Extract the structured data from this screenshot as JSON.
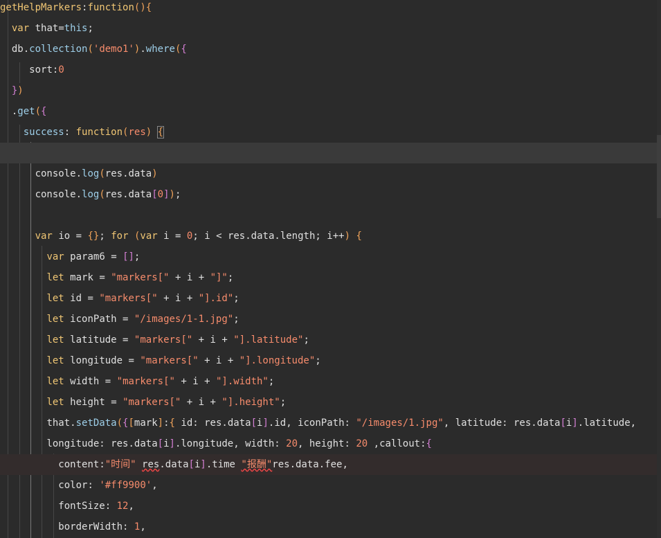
{
  "editor": {
    "lines": [
      "getHelpMarkers:function(){",
      "  var that=this;",
      "  db.collection('demo1').where({",
      "      sort:0",
      "  })",
      "  .get({",
      "    success: function(res) {",
      "",
      "      console.log(res.data)",
      "      console.log(res.data[0]);",
      "",
      "      var io = {}; for (var i = 0; i < res.data.length; i++) {",
      "        var param6 = [];",
      "        let mark = \"markers[\" + i + \"]\";",
      "        let id = \"markers[\" + i + \"].id\";",
      "        let iconPath = \"/images/1-1.jpg\";",
      "        let latitude = \"markers[\" + i + \"].latitude\";",
      "        let longitude = \"markers[\" + i + \"].longitude\";",
      "        let width = \"markers[\" + i + \"].width\";",
      "        let height = \"markers[\" + i + \"].height\";",
      "        that.setData({[mark]:{ id: res.data[i].id, iconPath: \"/images/1.jpg\", latitude: res.data[i].latitude,",
      "        longitude: res.data[i].longitude, width: 20, height: 20 ,callout:{",
      "          content:\"时间\" res.data[i].time \"报酬\"res.data.fee,",
      "          color: '#ff9900',",
      "          fontSize: 12,",
      "          borderWidth: 1,"
    ]
  }
}
